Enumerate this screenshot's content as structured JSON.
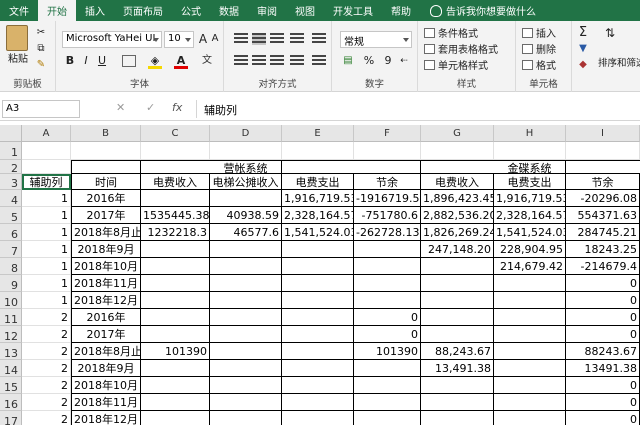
{
  "tabs": [
    "文件",
    "开始",
    "插入",
    "页面布局",
    "公式",
    "数据",
    "审阅",
    "视图",
    "开发工具",
    "帮助"
  ],
  "tell_me": "告诉我你想要做什么",
  "ribbon": {
    "paste_label": "粘贴",
    "clipboard_label": "剪贴板",
    "font_name": "Microsoft YaHei UI",
    "font_size": "10",
    "font_label": "字体",
    "align_label": "对齐方式",
    "number_format": "常规",
    "number_label": "数字",
    "style_items": [
      "条件格式",
      "套用表格格式",
      "单元格样式"
    ],
    "style_label": "样式",
    "cells_items": [
      "插入",
      "删除",
      "格式"
    ],
    "cells_label": "单元格",
    "sort_label": "排序和筛选",
    "bold": "B",
    "italic": "I",
    "underline": "U",
    "font_color_glyph": "A",
    "grow_font": "A",
    "shrink_font": "A",
    "percent": "%",
    "comma": "9",
    "sum_glyph": "Σ",
    "wen": "文"
  },
  "formula_bar": {
    "name_box": "A3",
    "fx": "fx",
    "content": "辅助列",
    "cancel": "✕",
    "enter": "✓"
  },
  "columns": [
    "A",
    "B",
    "C",
    "D",
    "E",
    "F",
    "G",
    "H",
    "I"
  ],
  "rows": [
    {
      "n": "1",
      "cells": [
        "",
        "",
        "",
        "",
        "",
        "",
        "",
        "",
        ""
      ]
    },
    {
      "n": "2",
      "cells": [
        "",
        "",
        "",
        "营帐系统",
        "",
        "",
        "",
        "金碟系统",
        ""
      ]
    },
    {
      "n": "3",
      "cells": [
        "辅助列",
        "时间",
        "电费收入",
        "电梯公摊收入",
        "电费支出",
        "节余",
        "电费收入",
        "电费支出",
        "节余"
      ]
    },
    {
      "n": "4",
      "cells": [
        "1",
        "2016年",
        "",
        "",
        "1,916,719.53",
        "-1916719.5",
        "1,896,423.45",
        "1,916,719.53",
        "-20296.08"
      ]
    },
    {
      "n": "5",
      "cells": [
        "1",
        "2017年",
        "1535445.38",
        "40938.59",
        "2,328,164.57",
        "-751780.6",
        "2,882,536.20",
        "2,328,164.57",
        "554371.63"
      ]
    },
    {
      "n": "6",
      "cells": [
        "1",
        "2018年8月止",
        "1232218.3",
        "46577.6",
        "1,541,524.03",
        "-262728.13",
        "1,826,269.24",
        "1,541,524.03",
        "284745.21"
      ]
    },
    {
      "n": "7",
      "cells": [
        "1",
        "2018年9月",
        "",
        "",
        "",
        "",
        "247,148.20",
        "228,904.95",
        "18243.25"
      ]
    },
    {
      "n": "8",
      "cells": [
        "1",
        "2018年10月",
        "",
        "",
        "",
        "",
        "",
        "214,679.42",
        "-214679.4"
      ]
    },
    {
      "n": "9",
      "cells": [
        "1",
        "2018年11月",
        "",
        "",
        "",
        "",
        "",
        "",
        "0"
      ]
    },
    {
      "n": "10",
      "cells": [
        "1",
        "2018年12月",
        "",
        "",
        "",
        "",
        "",
        "",
        "0"
      ]
    },
    {
      "n": "11",
      "cells": [
        "2",
        "2016年",
        "",
        "",
        "",
        "0",
        "",
        "",
        "0"
      ]
    },
    {
      "n": "12",
      "cells": [
        "2",
        "2017年",
        "",
        "",
        "",
        "0",
        "",
        "",
        "0"
      ]
    },
    {
      "n": "13",
      "cells": [
        "2",
        "2018年8月止",
        "101390",
        "",
        "",
        "101390",
        "88,243.67",
        "",
        "88243.67"
      ]
    },
    {
      "n": "14",
      "cells": [
        "2",
        "2018年9月",
        "",
        "",
        "",
        "",
        "13,491.38",
        "",
        "13491.38"
      ]
    },
    {
      "n": "15",
      "cells": [
        "2",
        "2018年10月",
        "",
        "",
        "",
        "",
        "",
        "",
        "0"
      ]
    },
    {
      "n": "16",
      "cells": [
        "2",
        "2018年11月",
        "",
        "",
        "",
        "",
        "",
        "",
        "0"
      ]
    },
    {
      "n": "17",
      "cells": [
        "2",
        "2018年12月",
        "",
        "",
        "",
        "",
        "",
        "",
        "0"
      ]
    }
  ],
  "colors": {
    "accent": "#217346",
    "ribbon_bg": "#f3f3f3",
    "header_bg": "#e6e6e6"
  }
}
